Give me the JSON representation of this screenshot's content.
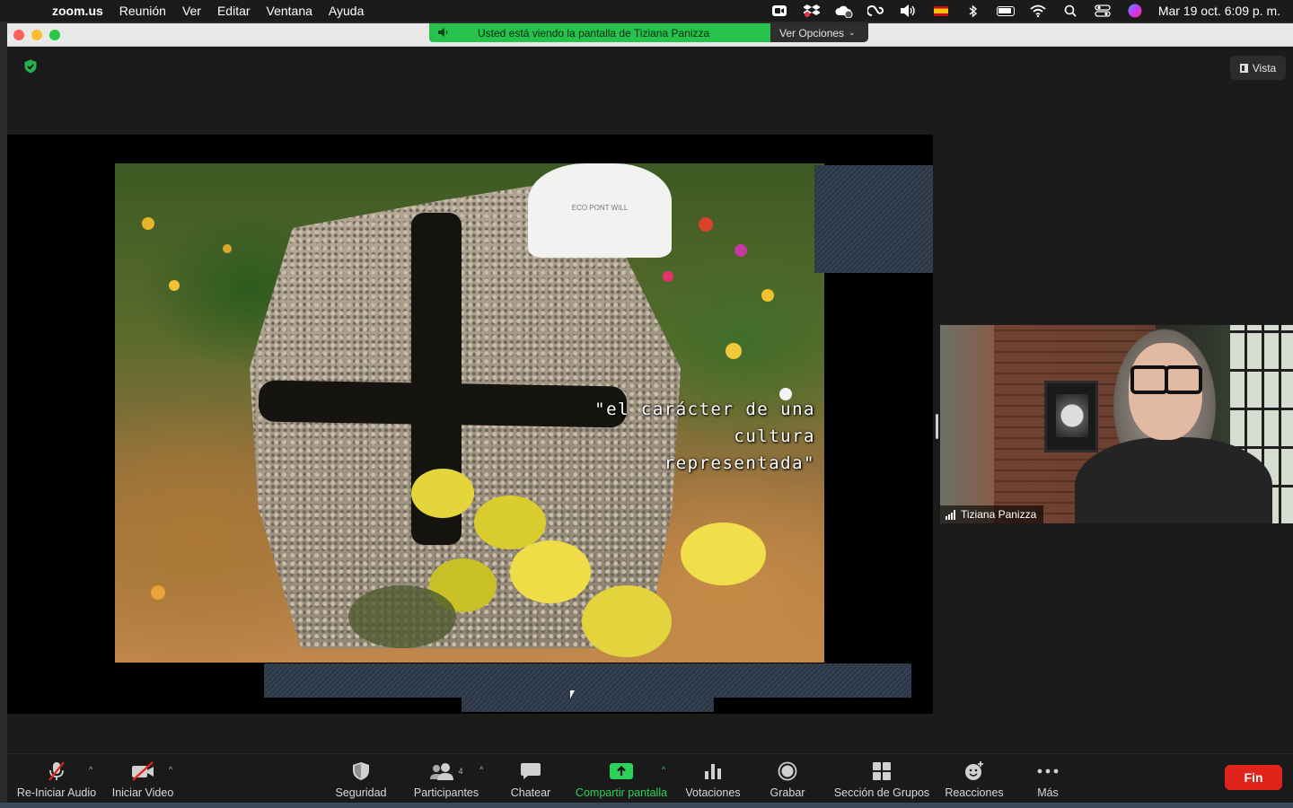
{
  "menubar": {
    "app_name": "zoom.us",
    "items": [
      "Reunión",
      "Ver",
      "Editar",
      "Ventana",
      "Ayuda"
    ],
    "clock": "Mar 19 oct.  6:09 p. m."
  },
  "banner": {
    "text": "Usted está viendo la pantalla de Tiziana Panizza",
    "options_label": "Ver Opciones"
  },
  "view_button": {
    "label": "Vista"
  },
  "shared": {
    "caption_line1": "\"el carácter de una",
    "caption_line2": "cultura representada\"",
    "stone_text": "ECO  PONT WILL"
  },
  "participant": {
    "name": "Tiziana Panizza"
  },
  "toolbar": {
    "audio": "Re-Iniciar Audio",
    "video": "Iniciar Video",
    "security": "Seguridad",
    "participants": "Participantes",
    "participants_count": "4",
    "chat": "Chatear",
    "share": "Compartir pantalla",
    "polls": "Votaciones",
    "record": "Grabar",
    "breakout": "Sección de Grupos",
    "reactions": "Reacciones",
    "more": "Más",
    "end": "Fin"
  },
  "colors": {
    "share_green": "#27c24c",
    "end_red": "#e0241b",
    "toolbar_bg": "#1a1a1a"
  }
}
